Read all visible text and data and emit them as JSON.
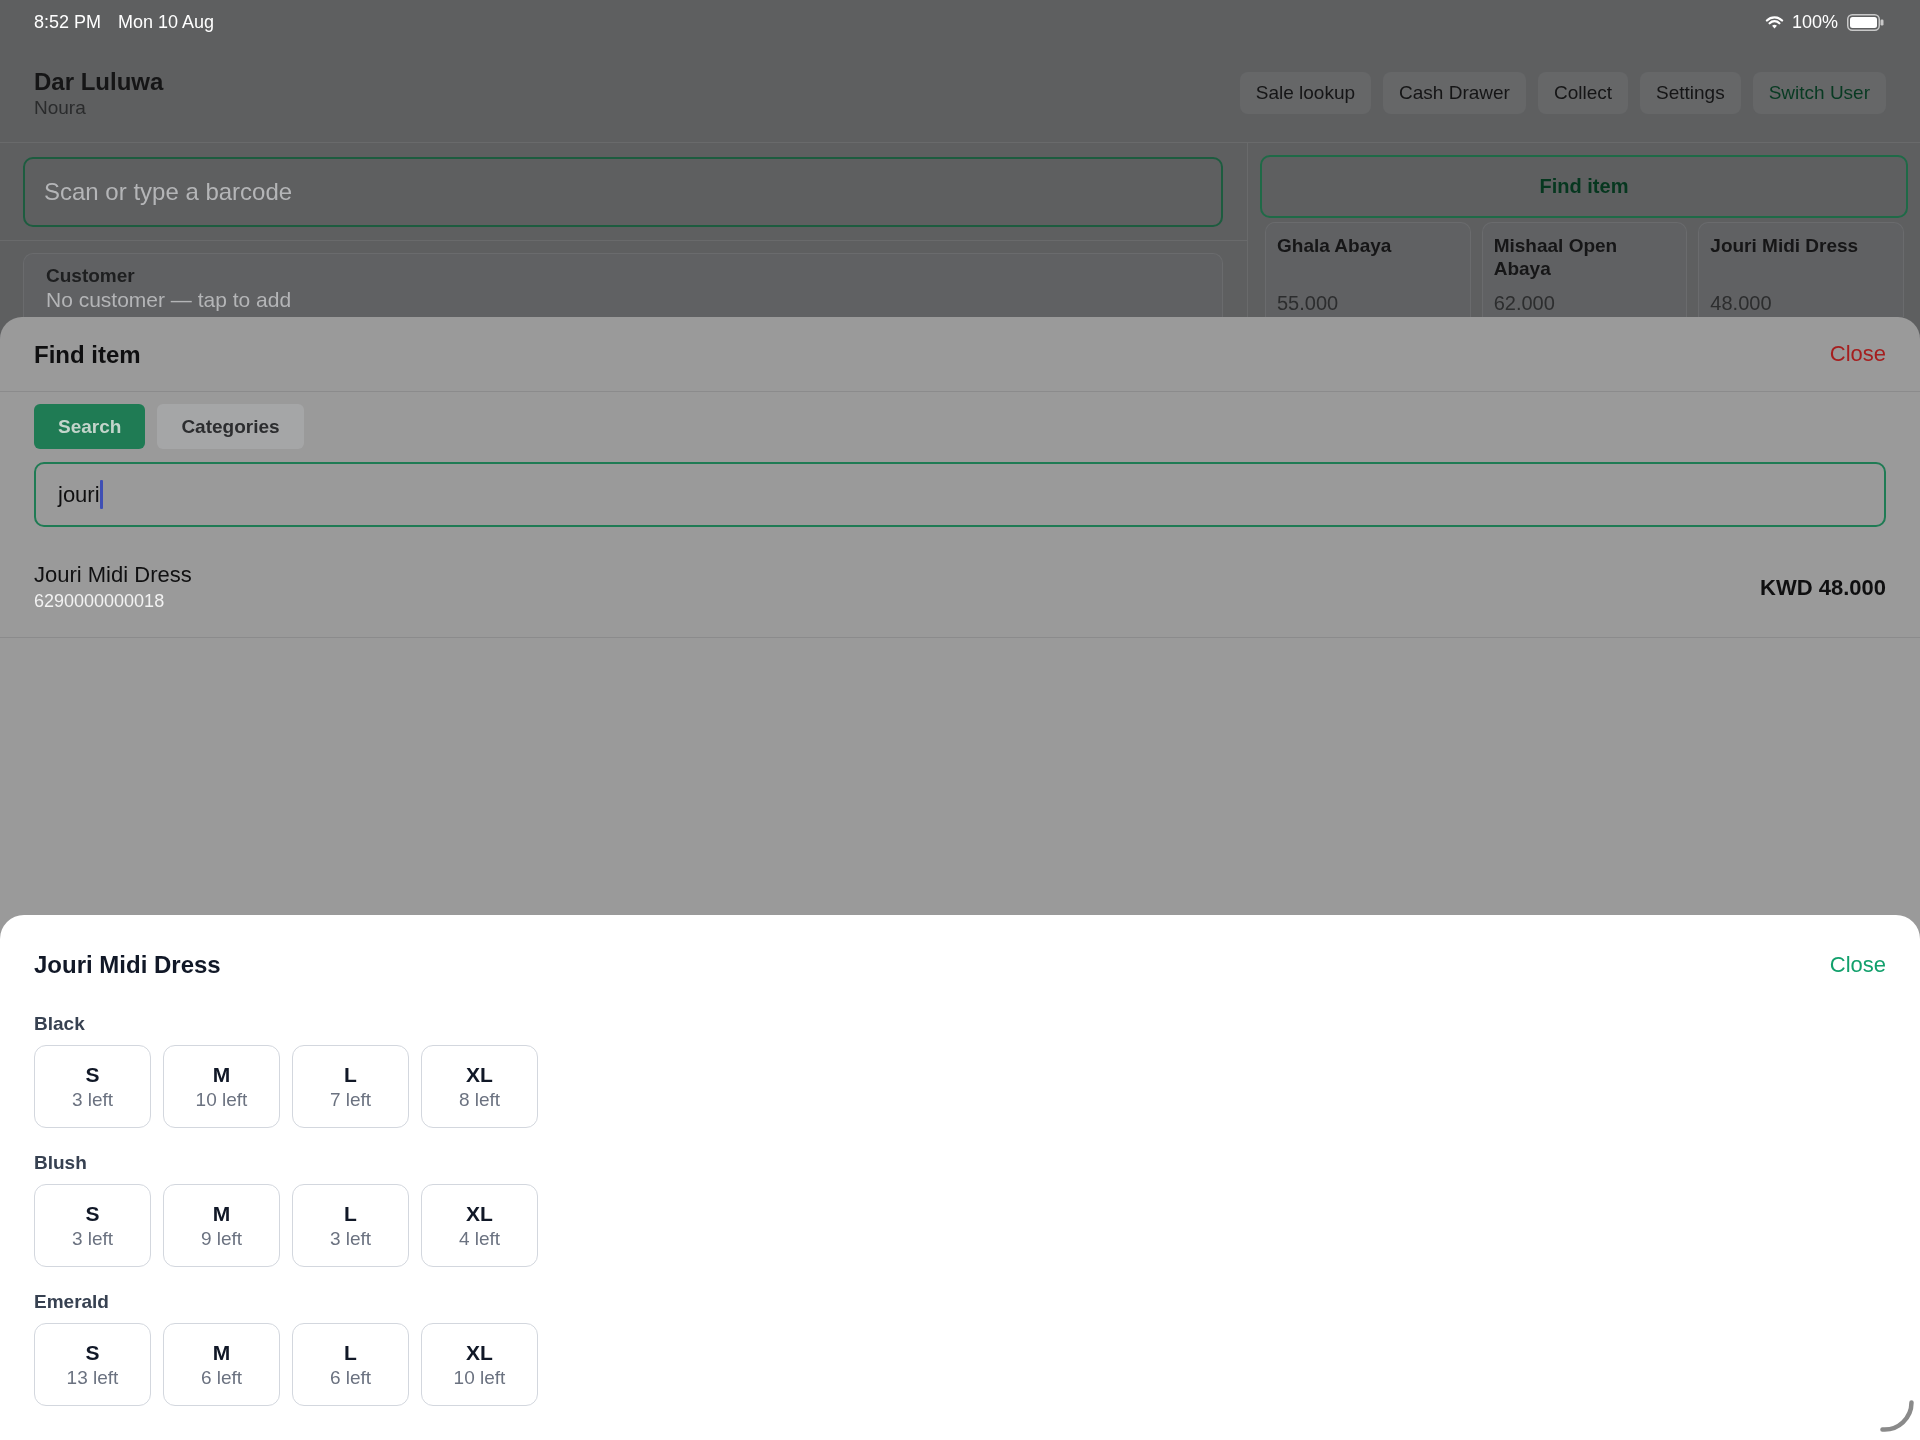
{
  "status_bar": {
    "time": "8:52 PM",
    "date": "Mon 10 Aug",
    "battery": "100%"
  },
  "header": {
    "title": "Dar Luluwa",
    "subtitle": "Noura",
    "actions": [
      {
        "label": "Sale lookup",
        "kind": "default"
      },
      {
        "label": "Cash Drawer",
        "kind": "default"
      },
      {
        "label": "Collect",
        "kind": "default"
      },
      {
        "label": "Settings",
        "kind": "default"
      },
      {
        "label": "Switch User",
        "kind": "accent"
      }
    ]
  },
  "barcode_field": {
    "placeholder": "Scan or type a barcode"
  },
  "customer": {
    "label": "Customer",
    "hint": "No customer — tap to add"
  },
  "find_item_button": {
    "label": "Find item"
  },
  "products": [
    {
      "name": "Ghala Abaya",
      "price": "55.000"
    },
    {
      "name": "Mishaal Open Abaya",
      "price": "62.000"
    },
    {
      "name": "Jouri Midi Dress",
      "price": "48.000"
    }
  ],
  "find_item_sheet": {
    "title": "Find item",
    "close": "Close",
    "tabs": [
      {
        "label": "Search",
        "selected": true
      },
      {
        "label": "Categories",
        "selected": false
      }
    ],
    "search": {
      "value": "jouri",
      "focused": true
    },
    "results": [
      {
        "name": "Jouri Midi Dress",
        "barcode": "6290000000018",
        "price": "KWD 48.000"
      }
    ]
  },
  "variant_sheet": {
    "title": "Jouri Midi Dress",
    "close": "Close",
    "colors": [
      {
        "name": "Black",
        "sizes": [
          {
            "size": "S",
            "stock": "3 left"
          },
          {
            "size": "M",
            "stock": "10 left"
          },
          {
            "size": "L",
            "stock": "7 left"
          },
          {
            "size": "XL",
            "stock": "8 left"
          }
        ]
      },
      {
        "name": "Blush",
        "sizes": [
          {
            "size": "S",
            "stock": "3 left"
          },
          {
            "size": "M",
            "stock": "9 left"
          },
          {
            "size": "L",
            "stock": "3 left"
          },
          {
            "size": "XL",
            "stock": "4 left"
          }
        ]
      },
      {
        "name": "Emerald",
        "sizes": [
          {
            "size": "S",
            "stock": "13 left"
          },
          {
            "size": "M",
            "stock": "6 left"
          },
          {
            "size": "L",
            "stock": "6 left"
          },
          {
            "size": "XL",
            "stock": "10 left"
          }
        ]
      }
    ]
  }
}
